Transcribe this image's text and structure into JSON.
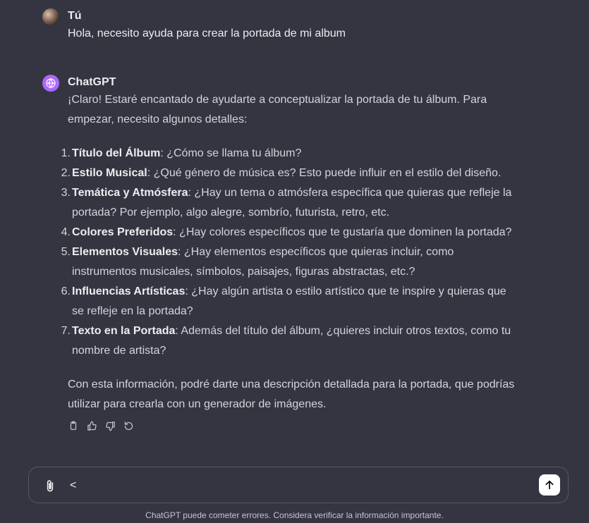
{
  "user_message": {
    "author": "Tú",
    "text": "Hola, necesito ayuda para crear la portada de mi album"
  },
  "assistant_message": {
    "author": "ChatGPT",
    "intro": "¡Claro! Estaré encantado de ayudarte a conceptualizar la portada de tu álbum. Para empezar, necesito algunos detalles:",
    "items": [
      {
        "number": "1.",
        "title": "Título del Álbum",
        "text": ": ¿Cómo se llama tu álbum?"
      },
      {
        "number": "2.",
        "title": "Estilo Musical",
        "text": ": ¿Qué género de música es? Esto puede influir en el estilo del diseño."
      },
      {
        "number": "3.",
        "title": "Temática y Atmósfera",
        "text": ": ¿Hay un tema o atmósfera específica que quieras que refleje la portada? Por ejemplo, algo alegre, sombrío, futurista, retro, etc."
      },
      {
        "number": "4.",
        "title": "Colores Preferidos",
        "text": ": ¿Hay colores específicos que te gustaría que dominen la portada?"
      },
      {
        "number": "5.",
        "title": "Elementos Visuales",
        "text": ": ¿Hay elementos específicos que quieras incluir, como instrumentos musicales, símbolos, paisajes, figuras abstractas, etc.?"
      },
      {
        "number": "6.",
        "title": "Influencias Artísticas",
        "text": ": ¿Hay algún artista o estilo artístico que te inspire y quieras que se refleje en la portada?"
      },
      {
        "number": "7.",
        "title": "Texto en la Portada",
        "text": ": Además del título del álbum, ¿quieres incluir otros textos, como tu nombre de artista?"
      }
    ],
    "outro": "Con esta información, podré darte una descripción detallada para la portada, que podrías utilizar para crearla con un generador de imágenes.",
    "actions": [
      "copy-icon",
      "thumbs-up-icon",
      "thumbs-down-icon",
      "regenerate-icon"
    ]
  },
  "composer": {
    "value": "<",
    "attach_icon": "paperclip-icon",
    "send_icon": "arrow-up-icon"
  },
  "disclaimer": "ChatGPT puede cometer errores. Considera verificar la información importante.",
  "colors": {
    "background": "#343541",
    "gpt_avatar": "#ab68ff",
    "border": "#565869"
  }
}
